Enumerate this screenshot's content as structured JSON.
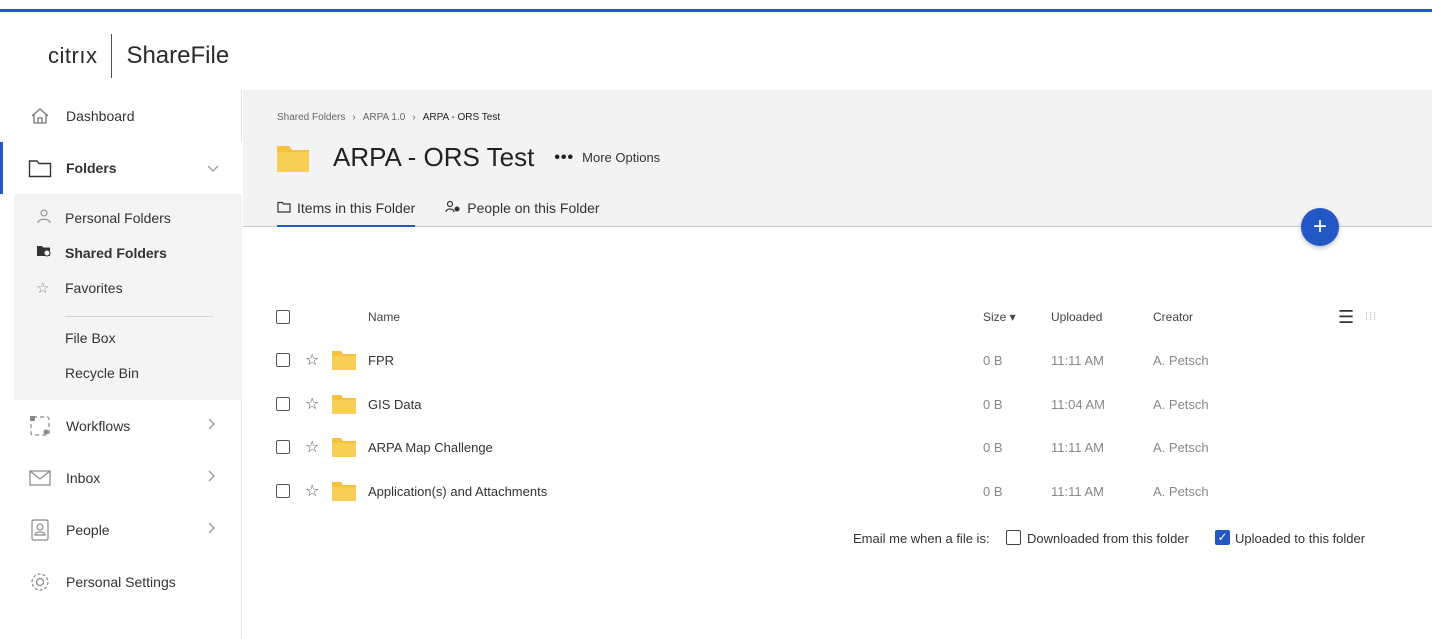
{
  "brand": {
    "citrix": "citrıx",
    "product": "ShareFile",
    "accent": "#2357c5",
    "folder_color": "#f6c23e"
  },
  "sidebar": {
    "dashboard": "Dashboard",
    "folders": "Folders",
    "sub": {
      "personal": "Personal Folders",
      "shared": "Shared Folders",
      "favorites": "Favorites",
      "filebox": "File Box",
      "recycle": "Recycle Bin"
    },
    "workflows": "Workflows",
    "inbox": "Inbox",
    "people": "People",
    "settings": "Personal Settings"
  },
  "breadcrumb": [
    "Shared Folders",
    "ARPA 1.0",
    "ARPA - ORS Test"
  ],
  "folder": {
    "title": "ARPA - ORS Test",
    "more_dots": "•••",
    "more_label": "More Options"
  },
  "tabs": [
    "Items in this Folder",
    "People on this Folder"
  ],
  "fab": "+",
  "columns": {
    "name": "Name",
    "size": "Size ▾",
    "uploaded": "Uploaded",
    "creator": "Creator"
  },
  "rows": [
    {
      "name": "FPR",
      "size": "0 B",
      "uploaded": "11:11 AM",
      "creator": "A. Petsch"
    },
    {
      "name": "GIS Data",
      "size": "0 B",
      "uploaded": "11:04 AM",
      "creator": "A. Petsch"
    },
    {
      "name": "ARPA Map Challenge",
      "size": "0 B",
      "uploaded": "11:11 AM",
      "creator": "A. Petsch"
    },
    {
      "name": "Application(s) and Attachments",
      "size": "0 B",
      "uploaded": "11:11 AM",
      "creator": "A. Petsch"
    }
  ],
  "email": {
    "label": "Email me when a file is:",
    "downloaded": "Downloaded from this folder",
    "downloaded_checked": false,
    "uploaded": "Uploaded to this folder",
    "uploaded_checked": true
  }
}
